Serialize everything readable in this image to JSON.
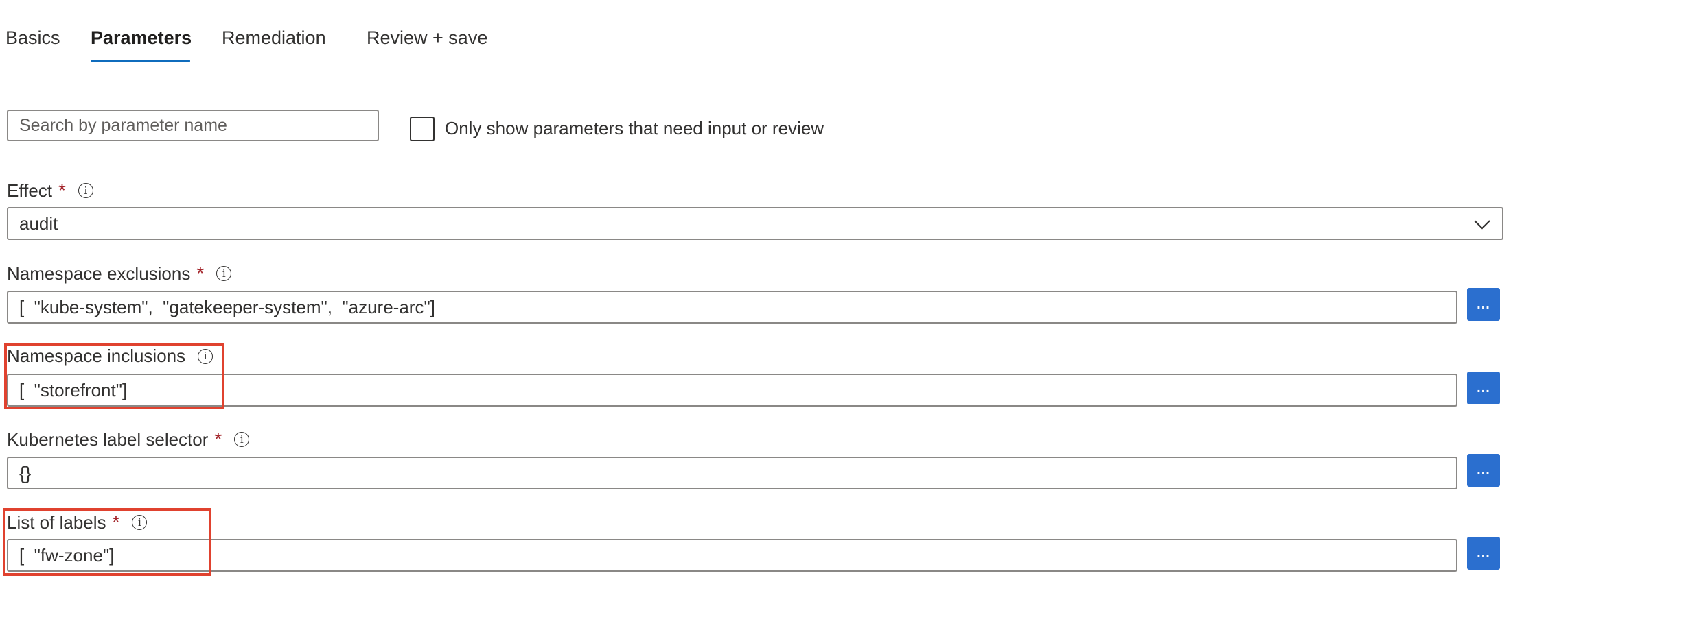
{
  "tabs": [
    {
      "label": "Basics"
    },
    {
      "label": "Parameters",
      "active": true
    },
    {
      "label": "Remediation"
    },
    {
      "label": "Review + save"
    }
  ],
  "search": {
    "placeholder": "Search by parameter name",
    "value": ""
  },
  "filter": {
    "label": "Only show parameters that need input or review",
    "checked": false
  },
  "fields": {
    "effect": {
      "label": "Effect",
      "required": "*",
      "value": "audit"
    },
    "namespace_exclusions": {
      "label": "Namespace exclusions",
      "required": "*",
      "value": "[  \"kube-system\",  \"gatekeeper-system\",  \"azure-arc\"]"
    },
    "namespace_inclusions": {
      "label": "Namespace inclusions",
      "value": "[  \"storefront\"]"
    },
    "label_selector": {
      "label": "Kubernetes label selector",
      "required": "*",
      "value": "{}"
    },
    "list_of_labels": {
      "label": "List of labels",
      "required": "*",
      "value": "[  \"fw-zone\"]"
    }
  },
  "info_glyph": "i",
  "edit_button_label": "...",
  "colors": {
    "accent": "#0f6cbd",
    "button": "#2b6fcf",
    "required": "#a4262c",
    "highlight": "#e0422f"
  },
  "icons": {
    "info": "info-icon",
    "dropdown": "chevron-down-icon"
  }
}
